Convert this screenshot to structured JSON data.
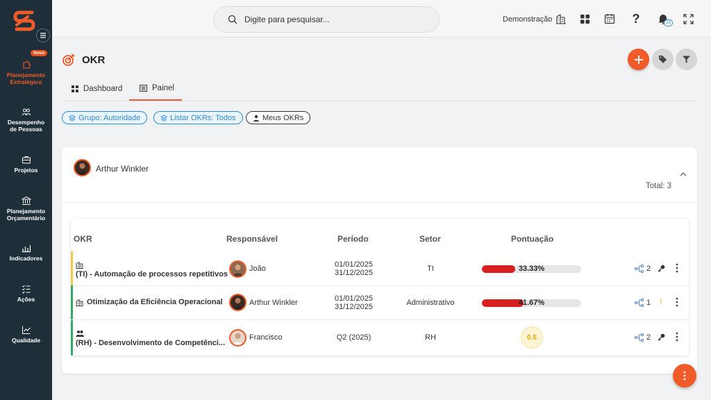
{
  "sidebar": {
    "new_badge": "Novo",
    "items": [
      {
        "label": "Planejamento Estratégico",
        "icon": "puzzle-icon"
      },
      {
        "label": "Desempenho de Pessoas",
        "icon": "people-icon"
      },
      {
        "label": "Projetos",
        "icon": "briefcase-icon"
      },
      {
        "label": "Planejamento Orçamentário",
        "icon": "bank-icon"
      },
      {
        "label": "Indicadores",
        "icon": "bar-chart-icon"
      },
      {
        "label": "Ações",
        "icon": "checklist-icon"
      },
      {
        "label": "Qualidade",
        "icon": "trend-icon"
      }
    ]
  },
  "topbar": {
    "search_placeholder": "Digite para pesquisar...",
    "company": "Demonstração",
    "notification_count": "21"
  },
  "page": {
    "title": "OKR",
    "tabs": [
      {
        "label": "Dashboard"
      },
      {
        "label": "Painel"
      }
    ],
    "active_tab": "Painel",
    "filters": [
      {
        "label": "Grupo: Autoridade"
      },
      {
        "label": "Listar OKRs: Todos"
      },
      {
        "label": "Meus OKRs"
      }
    ]
  },
  "card": {
    "user_name": "Arthur Winkler",
    "total_label": "Total: 3"
  },
  "table": {
    "headers": {
      "okr": "OKR",
      "responsible": "Responsável",
      "period": "Período",
      "sector": "Setor",
      "score": "Pontuação"
    },
    "rows": [
      {
        "icon": "building-icon",
        "name": "(TI) - Automação de processos repetitivos",
        "responsible": "João",
        "period_start": "01/01/2025",
        "period_end": "31/12/2025",
        "sector": "TI",
        "score_text": "33.33%",
        "score_fraction": 0.3333,
        "links": "2",
        "accent": "#f2c94c"
      },
      {
        "icon": "building-icon",
        "name": "Otimização da Eficiência Operacional",
        "responsible": "Arthur Winkler",
        "period_start": "01/01/2025",
        "period_end": "31/12/2025",
        "sector": "Administrativo",
        "score_text": "41.67%",
        "score_fraction": 0.4167,
        "links": "1",
        "accent": "#3aa66a"
      },
      {
        "icon": "people-icon",
        "name": "(RH) - Desenvolvimento de Competênci...",
        "responsible": "Francisco",
        "period_single": "Q2 (2025)",
        "sector": "RH",
        "score_text": "0.5",
        "links": "2",
        "accent": "#3aa66a"
      }
    ]
  },
  "colors": {
    "accent": "#f15a29",
    "sidebar": "#1e2f3a",
    "chip_blue": "#2c8bd9",
    "progress": "#d62020"
  }
}
